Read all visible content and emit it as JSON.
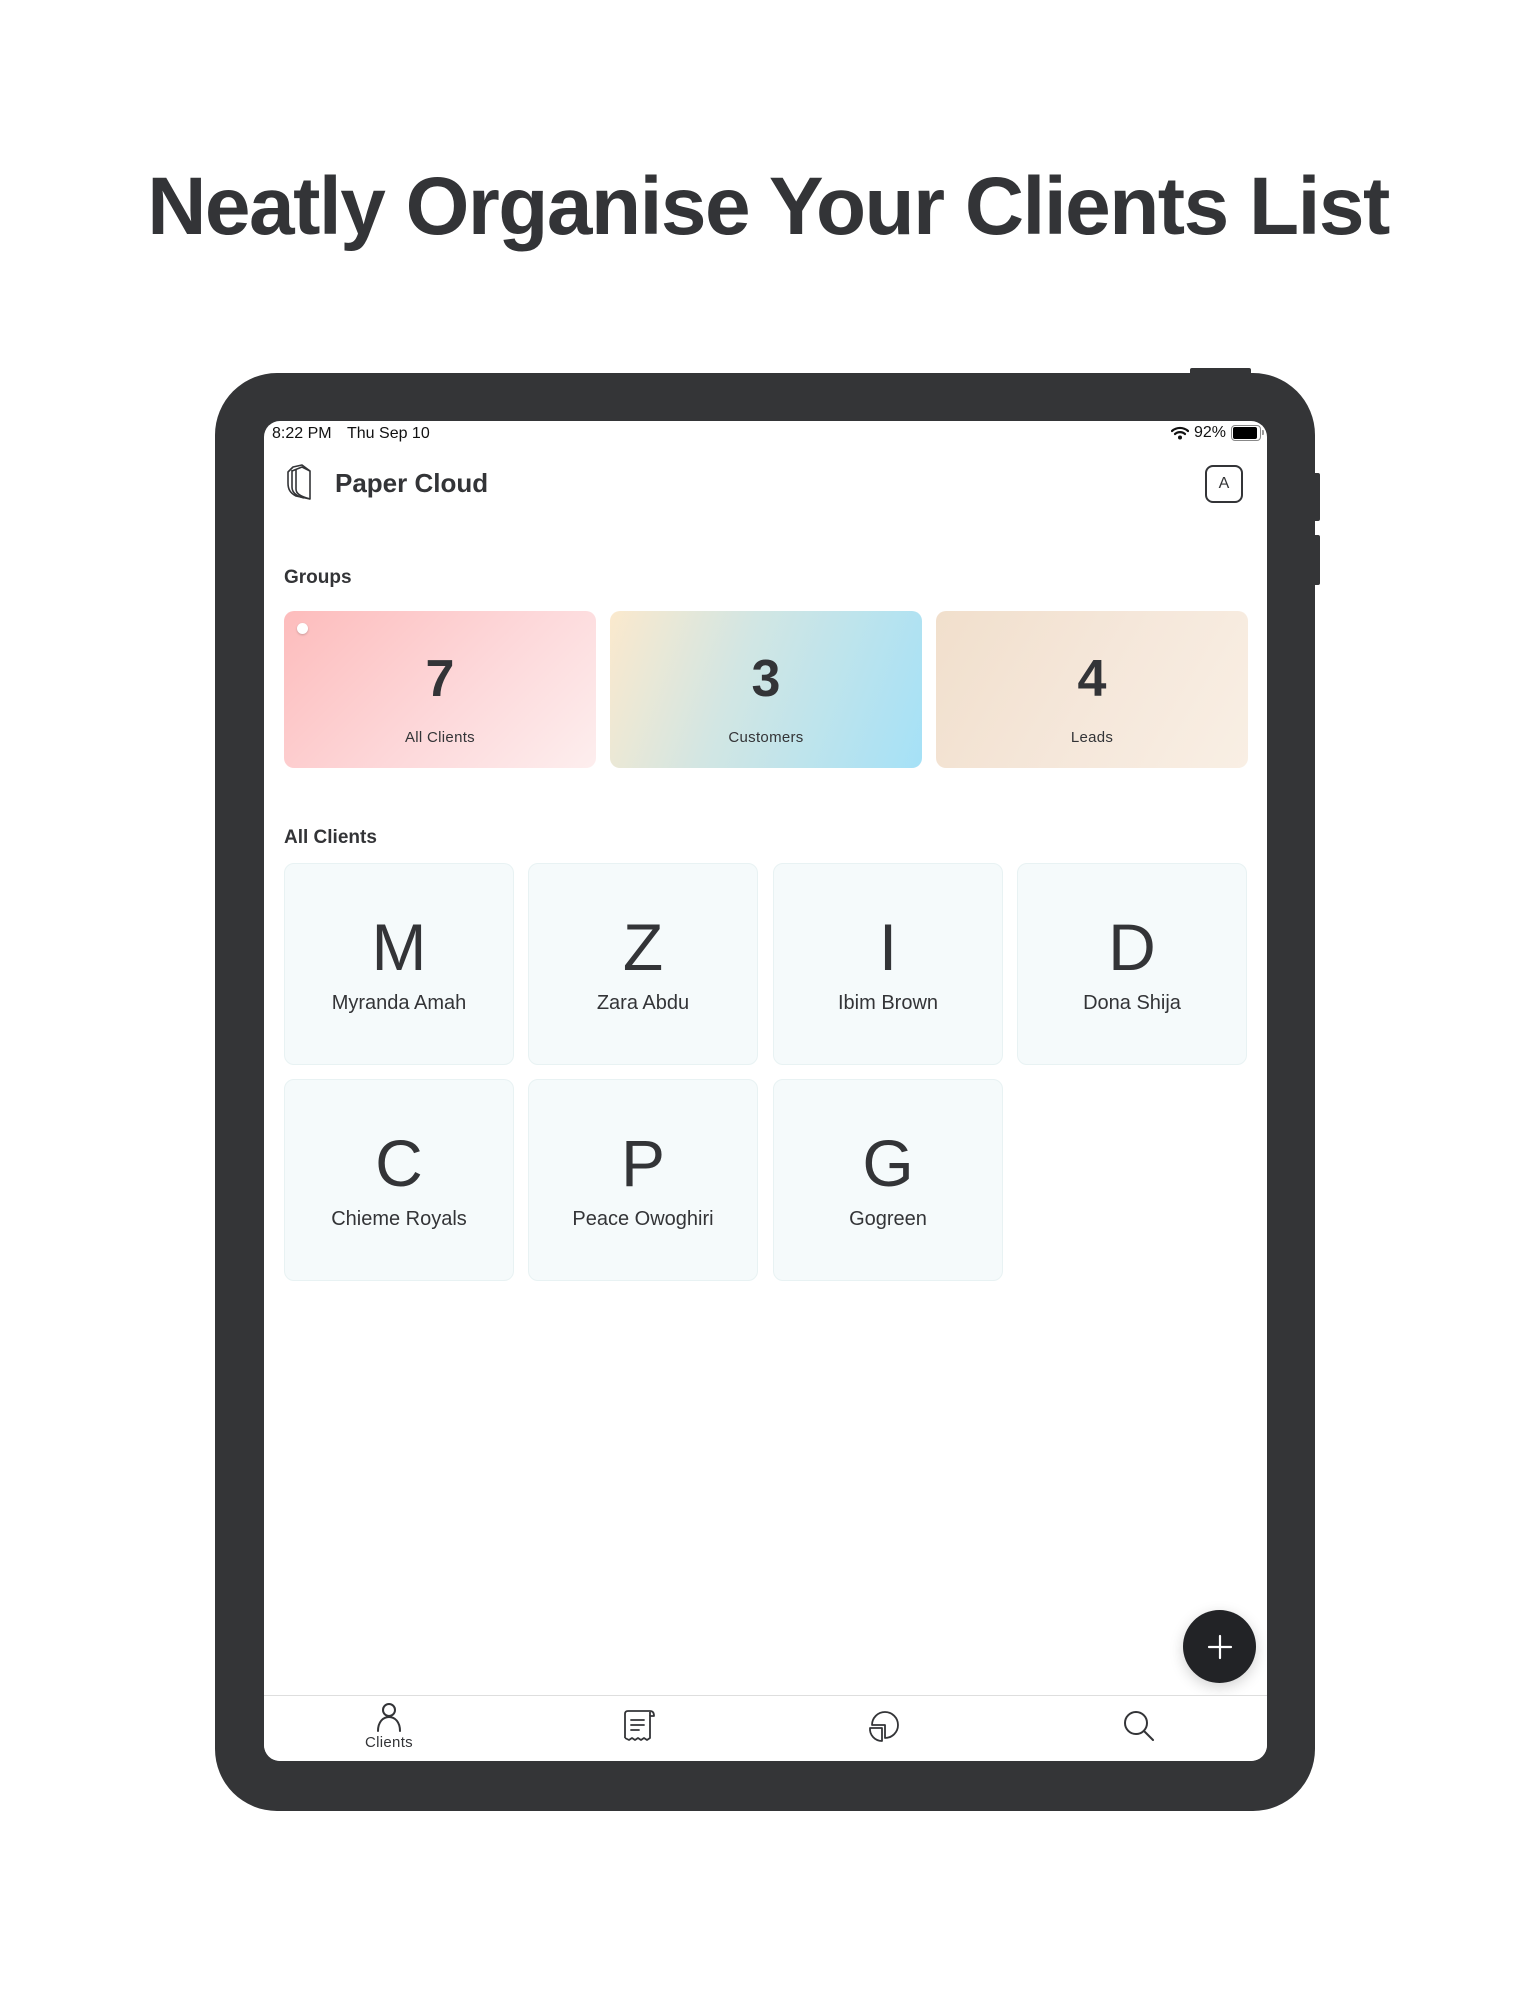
{
  "headline": "Neatly Organise Your Clients List",
  "status_bar": {
    "time": "8:22 PM",
    "date": "Thu Sep 10",
    "battery_percent": "92%",
    "battery_level": 0.92,
    "wifi_icon": "wifi-icon"
  },
  "app": {
    "title": "Paper Cloud",
    "logo_icon": "paper-stack-icon",
    "avatar_initial": "A"
  },
  "groups": {
    "label": "Groups",
    "items": [
      {
        "count": "7",
        "label": "All Clients",
        "selected": true
      },
      {
        "count": "3",
        "label": "Customers"
      },
      {
        "count": "4",
        "label": "Leads"
      }
    ]
  },
  "clients": {
    "label": "All Clients",
    "items": [
      {
        "initial": "M",
        "name": "Myranda Amah"
      },
      {
        "initial": "Z",
        "name": "Zara Abdu"
      },
      {
        "initial": "I",
        "name": "Ibim Brown"
      },
      {
        "initial": "D",
        "name": "Dona Shija"
      },
      {
        "initial": "C",
        "name": "Chieme Royals"
      },
      {
        "initial": "P",
        "name": "Peace Owoghiri"
      },
      {
        "initial": "G",
        "name": "Gogreen"
      }
    ]
  },
  "fab": {
    "icon": "plus-icon"
  },
  "tabbar": {
    "tabs": [
      {
        "icon": "person-icon",
        "label": "Clients",
        "active": true
      },
      {
        "icon": "receipt-icon",
        "label": ""
      },
      {
        "icon": "pie-chart-icon",
        "label": ""
      },
      {
        "icon": "search-icon",
        "label": ""
      }
    ]
  },
  "colors": {
    "text": "#333437",
    "device_frame": "#343537",
    "fab": "#222326",
    "client_card_bg": "#f5fafb"
  }
}
